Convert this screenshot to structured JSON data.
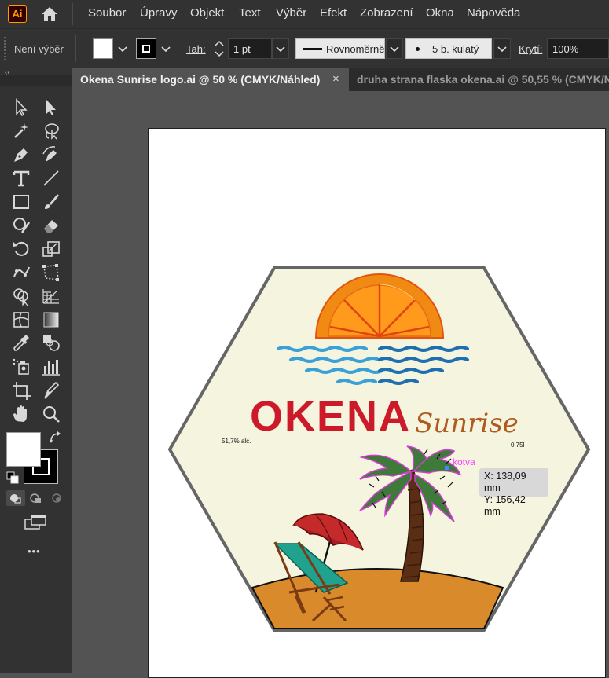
{
  "app": {
    "logo_text": "Ai",
    "menu": [
      "Soubor",
      "Úpravy",
      "Objekt",
      "Text",
      "Výběr",
      "Efekt",
      "Zobrazení",
      "Okna",
      "Nápověda"
    ]
  },
  "control_bar": {
    "selection_label": "Není výběr",
    "stroke_label": "Tah:",
    "stroke_weight": "1 pt",
    "profile": "Rovnoměrně",
    "brush": "5 b. kulatý",
    "opacity_label": "Krytí:",
    "opacity_value": "100%"
  },
  "tabs": [
    {
      "label": "Okena Sunrise logo.ai @ 50 % (CMYK/Náhled)",
      "active": true,
      "close_glyph": "×"
    },
    {
      "label": "druha strana flaska okena.ai @ 50,55 % (CMYK/Ná",
      "active": false
    }
  ],
  "toolbar": {
    "collapse_glyph": "‹‹",
    "more_glyph": "•••",
    "tools": [
      "selection-icon",
      "direct-selection-icon",
      "magic-wand-icon",
      "lasso-icon",
      "pen-icon",
      "curvature-icon",
      "type-icon",
      "line-segment-icon",
      "rectangle-icon",
      "paintbrush-icon",
      "shaper-icon",
      "eraser-icon",
      "rotate-icon",
      "scale-icon",
      "puppet-warp-icon",
      "free-transform-icon",
      "shape-builder-icon",
      "perspective-grid-icon",
      "mesh-icon",
      "gradient-icon",
      "eyedropper-icon",
      "blend-icon",
      "symbol-sprayer-icon",
      "column-graph-icon",
      "artboard-icon",
      "slice-icon",
      "hand-icon",
      "zoom-icon"
    ]
  },
  "artwork": {
    "brand": "OKENA",
    "tagline": "Sunrise",
    "alcohol": "51,7% alc.",
    "volume": "0,75l",
    "colors": {
      "background": "#f4f4df",
      "border": "#666666",
      "brand_red": "#cc1a2a",
      "tagline_brown": "#b05a1e",
      "orange": "#f18a12",
      "water_light": "#3aa0d8",
      "water_dark": "#1e6eb0",
      "sand": "#d98a2a",
      "palm_green": "#3f7a3a",
      "umbrella_red": "#a81c22",
      "chair_teal": "#1fa38f"
    }
  },
  "smart_guide": {
    "anchor_label": "kotva",
    "x_readout": "X: 138,09 mm",
    "y_readout": "Y: 156,42 mm"
  }
}
